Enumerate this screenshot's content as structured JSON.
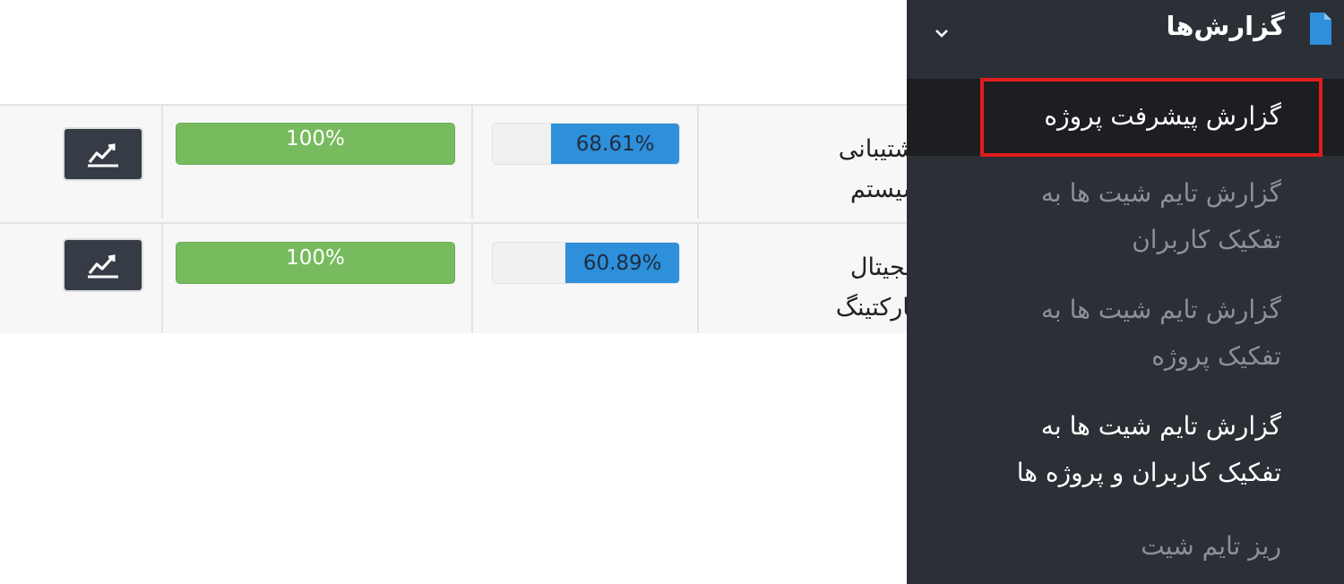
{
  "table": {
    "rows": [
      {
        "name_line1": "پشتیبانی",
        "name_line2": "سیستم",
        "progress_label": "68.61%",
        "progress_value": 68.61,
        "complete_label": "100%"
      },
      {
        "name_line1": "دیجیتال",
        "name_line2": "مارکتینگ",
        "progress_label": "60.89%",
        "progress_value": 60.89,
        "complete_label": "100%"
      }
    ]
  },
  "sidebar": {
    "section_title": "گزارش‌ها",
    "section_icon": "document-icon",
    "expand_icon": "chevron-down-icon",
    "items": [
      {
        "label": "گزارش پیشرفت پروژه"
      },
      {
        "label_line1": "گزارش تایم شیت ها به",
        "label_line2": "تفکیک کاربران"
      },
      {
        "label_line1": "گزارش تایم شیت ها به",
        "label_line2": "تفکیک پروژه"
      },
      {
        "label_line1": "گزارش تایم شیت ها به",
        "label_line2": "تفکیک کاربران و پروژه ها"
      },
      {
        "label": "ریز تایم شیت"
      }
    ]
  },
  "colors": {
    "sidebar_bg": "#2b2f36",
    "active_item_bg": "#1c1e22",
    "accent_blue": "#2e8fdb",
    "success_green": "#78bb5e",
    "highlight_red": "#e21c1c"
  }
}
